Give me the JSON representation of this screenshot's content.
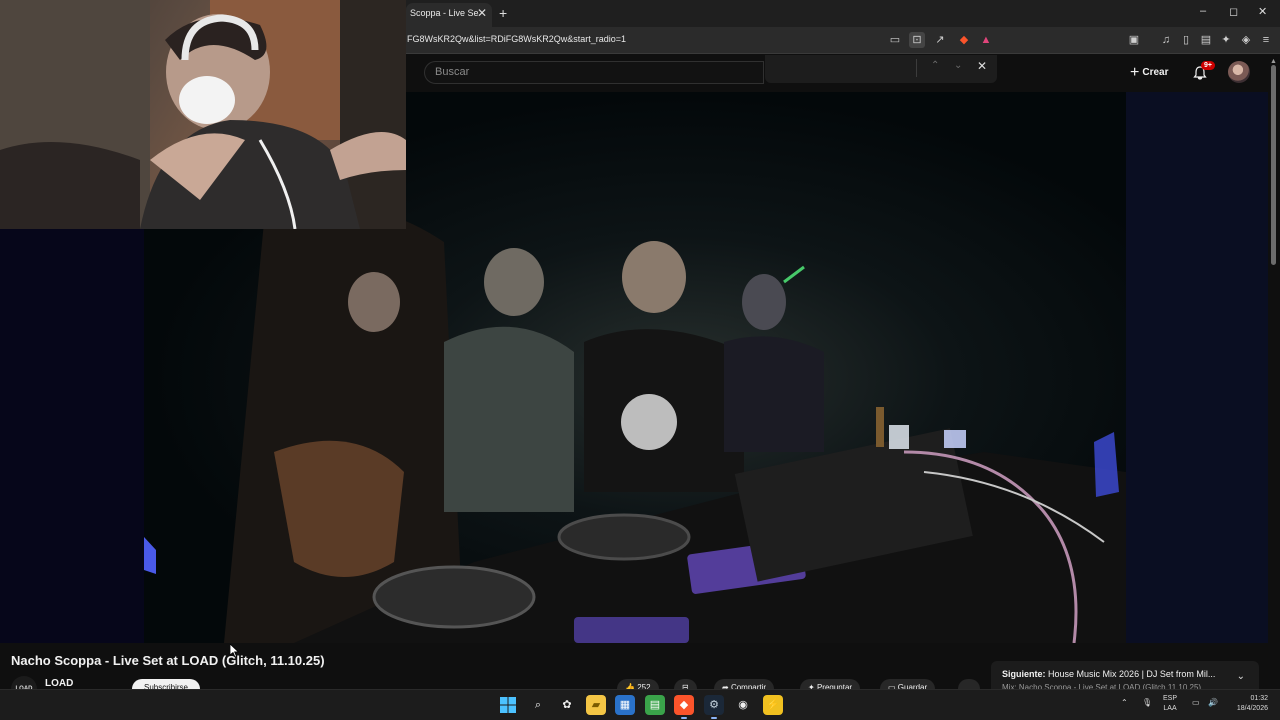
{
  "browser": {
    "tab_title": "Scoppa - Live Se",
    "tab_close": "✕",
    "new_tab": "+",
    "url": "FG8WsKR2Qw&list=RDiFG8WsKR2Qw&start_radio=1",
    "window_controls": {
      "minimize": "–",
      "maximize": "◻",
      "close": "✕"
    }
  },
  "youtube": {
    "search_placeholder": "Buscar",
    "find_close": "✕",
    "create_plus": "+",
    "create_label": "Crear",
    "notifications_badge": "9+",
    "video_title": "Nacho Scoppa - Live Set at LOAD (Glitch, 11.10.25)",
    "channel": {
      "logo_text": "LOAD",
      "name": "LOAD",
      "subscribe_label": "Subscribirse"
    },
    "actions": [
      {
        "label": "252"
      },
      {
        "label": ""
      },
      {
        "label": "Compartir"
      },
      {
        "label": "Preguntar"
      },
      {
        "label": "Guardar"
      }
    ],
    "next_up": {
      "label": "Siguiente:",
      "title": "House Music Mix 2026 | DJ Set from Mil...",
      "subtitle": "Mix: Nacho Scoppa - Live Set at LOAD (Glitch 11.10.25)",
      "chevron": "⌄"
    }
  },
  "taskbar": {
    "language": {
      "line1": "ESP",
      "line2": "LAA"
    },
    "clock": {
      "time": "01:32",
      "date": "18/4/2026"
    }
  }
}
